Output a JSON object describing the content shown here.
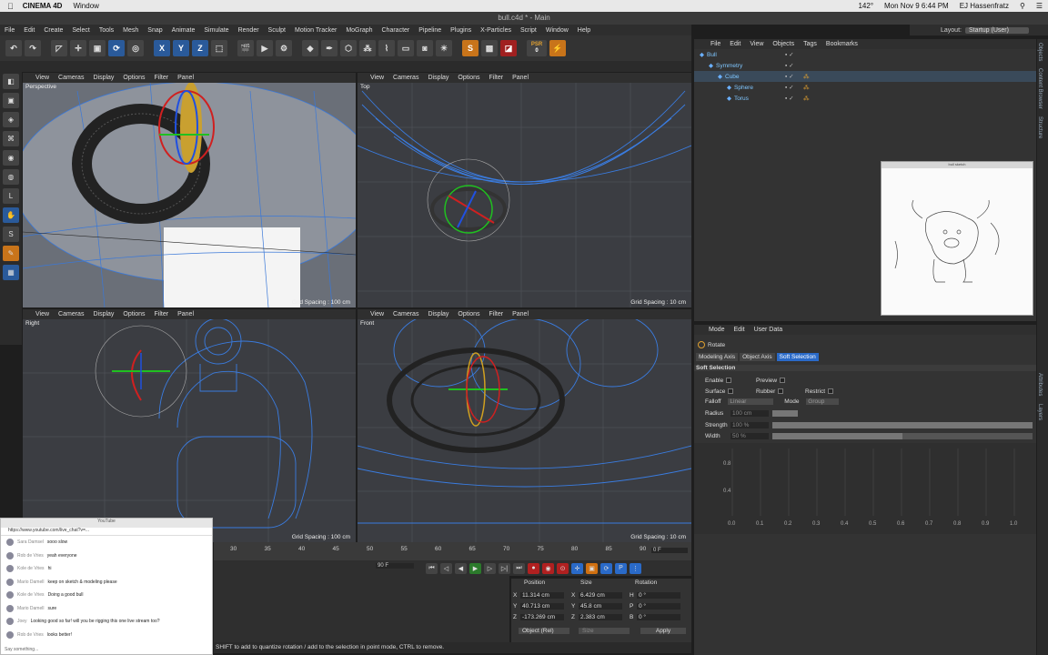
{
  "mac": {
    "app": "CINEMA 4D",
    "menu": "Window",
    "status": "142°",
    "date": "Mon Nov 9  6:44 PM",
    "user": "EJ Hassenfratz"
  },
  "window": {
    "title": "bull.c4d * - Main"
  },
  "menus": [
    "File",
    "Edit",
    "Create",
    "Select",
    "Tools",
    "Mesh",
    "Snap",
    "Animate",
    "Simulate",
    "Render",
    "Sculpt",
    "Motion Tracker",
    "MoGraph",
    "Character",
    "Pipeline",
    "Plugins",
    "X-Particles",
    "Script",
    "Window",
    "Help"
  ],
  "layout": {
    "label": "Layout:",
    "value": "Startup (User)"
  },
  "toolbar": {
    "x": "X",
    "y": "Y",
    "z": "Z",
    "psr_label": "PSR",
    "psr_value": "0"
  },
  "lefttools": [
    "◧",
    "▣",
    "◈",
    "⌘",
    "◉",
    "◍",
    "L",
    "✋",
    "S",
    "✎",
    "▦"
  ],
  "viewports": [
    {
      "id": "perspective",
      "menus": [
        "View",
        "Cameras",
        "Display",
        "Options",
        "Filter",
        "Panel"
      ],
      "name": "Perspective",
      "grid": "Grid Spacing : 100 cm"
    },
    {
      "id": "top",
      "menus": [
        "View",
        "Cameras",
        "Display",
        "Options",
        "Filter",
        "Panel"
      ],
      "name": "Top",
      "grid": "Grid Spacing : 10 cm"
    },
    {
      "id": "right",
      "menus": [
        "View",
        "Cameras",
        "Display",
        "Options",
        "Filter",
        "Panel"
      ],
      "name": "Right",
      "grid": "Grid Spacing : 100 cm"
    },
    {
      "id": "front",
      "menus": [
        "View",
        "Cameras",
        "Display",
        "Options",
        "Filter",
        "Panel"
      ],
      "name": "Front",
      "grid": "Grid Spacing : 10 cm"
    }
  ],
  "objects": {
    "menus": [
      "File",
      "Edit",
      "View",
      "Objects",
      "Tags",
      "Bookmarks"
    ],
    "items": [
      {
        "name": "Bull",
        "indent": 0
      },
      {
        "name": "Symmetry",
        "indent": 1
      },
      {
        "name": "Cube",
        "indent": 2
      },
      {
        "name": "Sphere",
        "indent": 3
      },
      {
        "name": "Torus",
        "indent": 3
      }
    ]
  },
  "reference": {
    "header": "bull sketch"
  },
  "right_tabs": [
    "Objects",
    "Content Browser",
    "Structure",
    "Attributes",
    "Layers"
  ],
  "attributes": {
    "menus": [
      "Mode",
      "Edit",
      "User Data"
    ],
    "tool": "Rotate",
    "tabs": [
      "Modeling Axis",
      "Object Axis",
      "Soft Selection"
    ],
    "section": "Soft Selection",
    "enable": "Enable",
    "preview": "Preview",
    "surface": "Surface",
    "rubber": "Rubber",
    "restrict": "Restrict",
    "falloff_label": "Falloff",
    "falloff_value": "Linear",
    "mode_label": "Mode",
    "mode_value": "Group",
    "radius_label": "Radius",
    "radius_value": "100 cm",
    "strength_label": "Strength",
    "strength_value": "100 %",
    "strength": 1.0,
    "width_label": "Width",
    "width_value": "50 %",
    "width": 0.5,
    "graph_y": [
      "0.8",
      "0.4"
    ],
    "graph_x": [
      "0.0",
      "0.1",
      "0.2",
      "0.3",
      "0.4",
      "0.5",
      "0.6",
      "0.7",
      "0.8",
      "0.9",
      "1.0"
    ]
  },
  "timeline": {
    "ticks": [
      "30",
      "35",
      "40",
      "45",
      "50",
      "55",
      "60",
      "65",
      "70",
      "75",
      "80",
      "85",
      "90"
    ],
    "frame": "0 F",
    "end": "90 F"
  },
  "coords": {
    "headers": [
      "Position",
      "Size",
      "Rotation"
    ],
    "rows": [
      {
        "axis": "X",
        "pos": "11.314 cm",
        "sa": "X",
        "size": "6.429 cm",
        "ra": "H",
        "rot": "0 °"
      },
      {
        "axis": "Y",
        "pos": "40.713 cm",
        "sa": "Y",
        "size": "45.8 cm",
        "ra": "P",
        "rot": "0 °"
      },
      {
        "axis": "Z",
        "pos": "-173.269 cm",
        "sa": "Z",
        "size": "2.383 cm",
        "ra": "B",
        "rot": "0 °"
      }
    ],
    "mode": "Object (Rel)",
    "size_mode": "Size",
    "apply": "Apply"
  },
  "status": "SHIFT to add to quantize rotation / add to the selection in point mode, CTRL to remove.",
  "chat": {
    "title": "YouTube",
    "url": "https://www.youtube.com/live_chat?v=...",
    "messages": [
      {
        "who": "Sara Damsel",
        "text": "sooo slow"
      },
      {
        "who": "Rob de Vries",
        "text": "yeah everyone"
      },
      {
        "who": "Kole de Vries",
        "text": "hi"
      },
      {
        "who": "Mario Damell",
        "text": "keep on sketch & modeling please"
      },
      {
        "who": "Kole de Vries",
        "text": "Doing a good bull"
      },
      {
        "who": "Mario Damell",
        "text": "sure"
      },
      {
        "who": "Joey",
        "text": "Looking good so far! will you be rigging this one live stream too?"
      },
      {
        "who": "Rob de Vries",
        "text": "looks better!"
      }
    ],
    "input": "Say something..."
  }
}
